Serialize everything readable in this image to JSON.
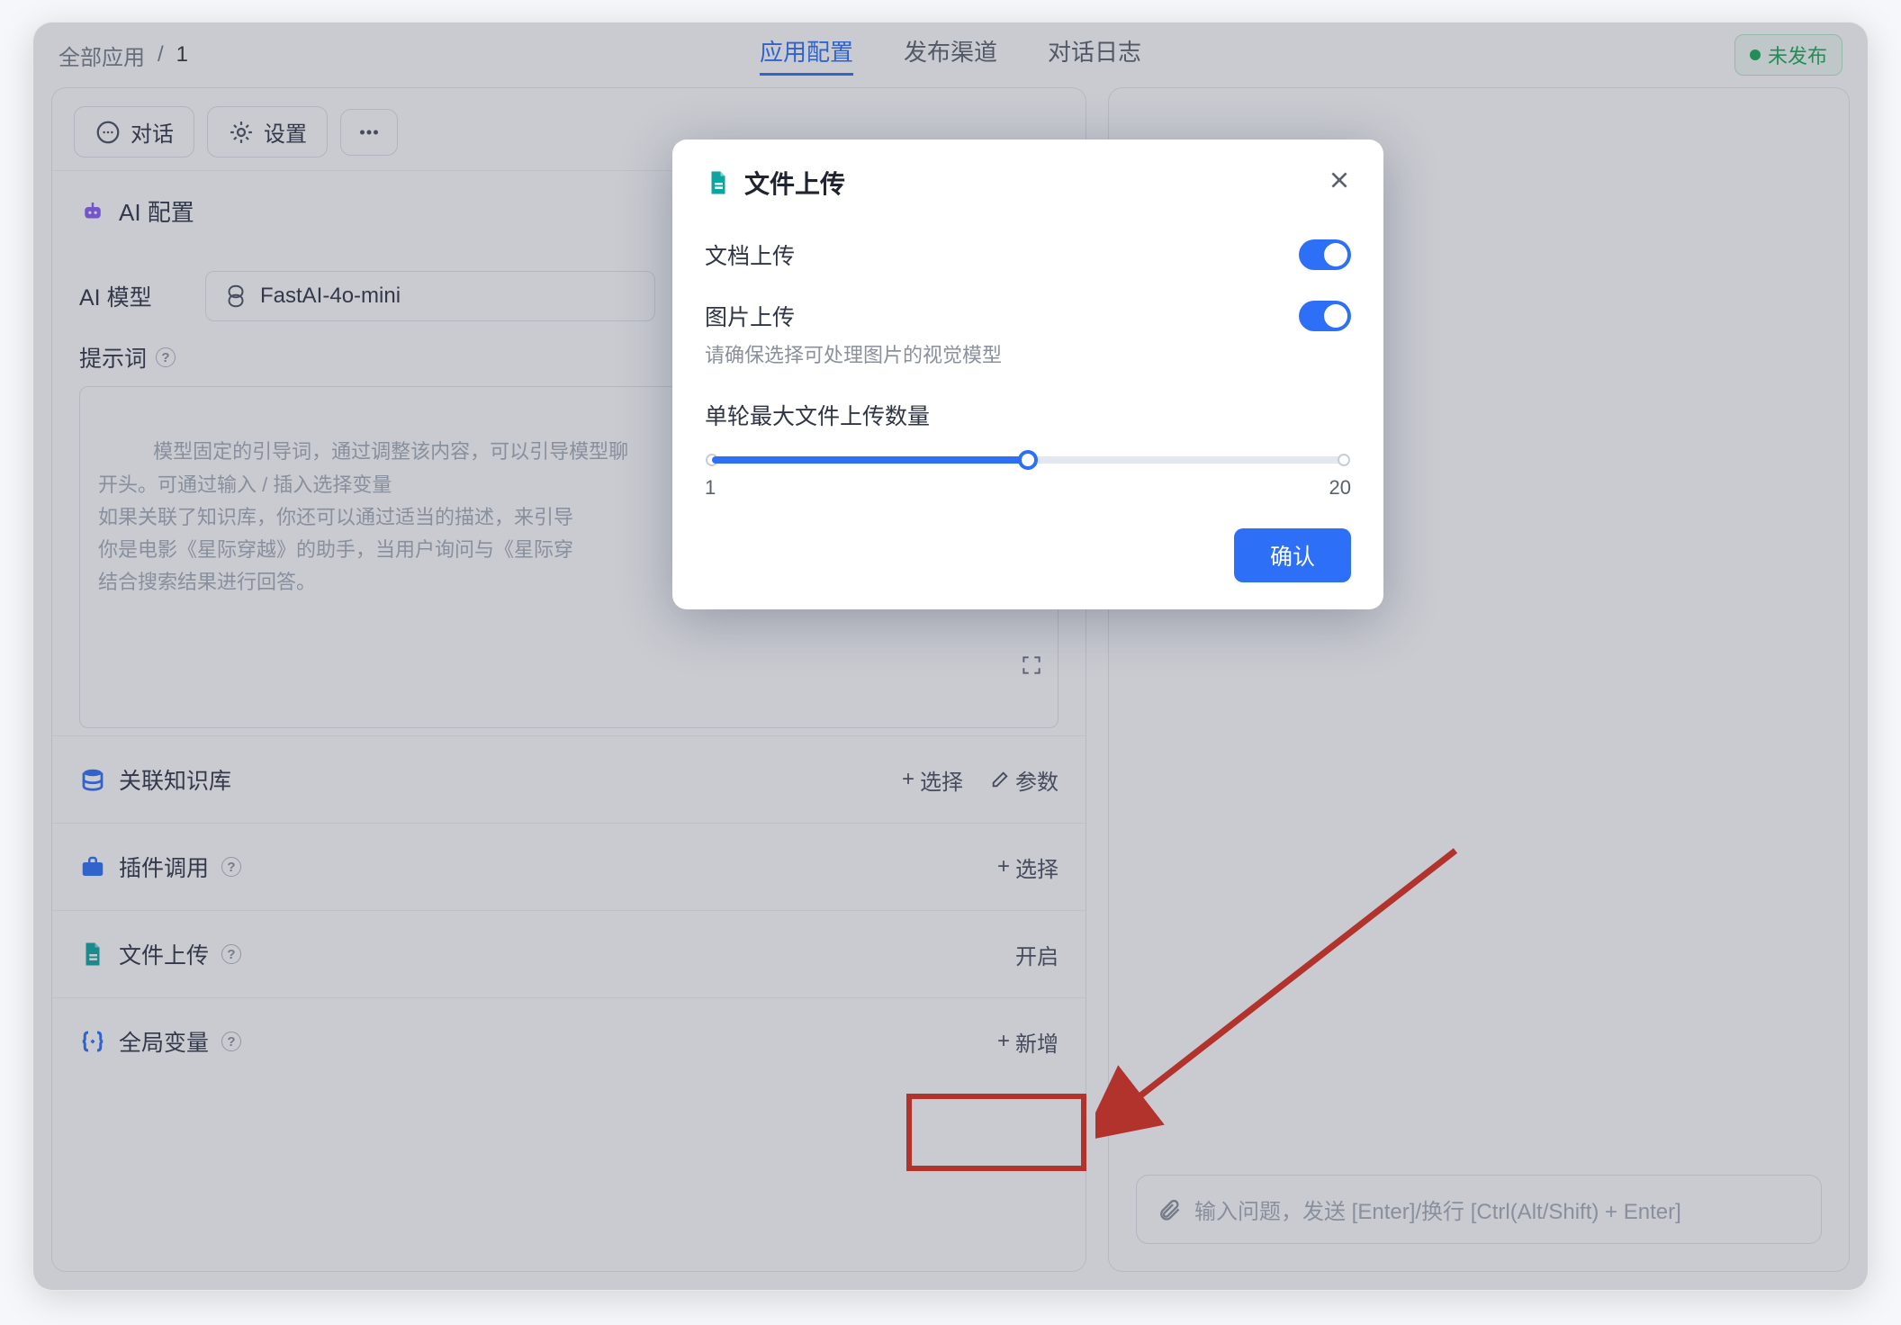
{
  "breadcrumb": {
    "root": "全部应用",
    "sep": "/",
    "current": "1"
  },
  "tabs": {
    "config": "应用配置",
    "channels": "发布渠道",
    "logs": "对话日志"
  },
  "publish": {
    "label": "未发布"
  },
  "toolbar": {
    "chat": "对话",
    "settings": "设置"
  },
  "ai_section": {
    "title": "AI 配置",
    "model_label": "AI 模型",
    "model_value": "FastAI-4o-mini"
  },
  "prompt": {
    "label": "提示词",
    "placeholder": "模型固定的引导词，通过调整该内容，可以引导模型聊\n开头。可通过输入 / 插入选择变量\n如果关联了知识库，你还可以通过适当的描述，来引导\n你是电影《星际穿越》的助手，当用户询问与《星际穿\n结合搜索结果进行回答。"
  },
  "rows": {
    "kb": {
      "title": "关联知识库",
      "select": "选择",
      "params": "参数"
    },
    "plugin": {
      "title": "插件调用",
      "select": "选择"
    },
    "upload": {
      "title": "文件上传",
      "enable": "开启"
    },
    "globals": {
      "title": "全局变量",
      "add": "新增"
    }
  },
  "chat_input": {
    "placeholder": "输入问题，发送 [Enter]/换行 [Ctrl(Alt/Shift) + Enter]"
  },
  "modal": {
    "title": "文件上传",
    "doc_upload": "文档上传",
    "img_upload": "图片上传",
    "img_hint": "请确保选择可处理图片的视觉模型",
    "max_label": "单轮最大文件上传数量",
    "min": "1",
    "max": "20",
    "confirm": "确认",
    "slider_value_pct": 50
  }
}
